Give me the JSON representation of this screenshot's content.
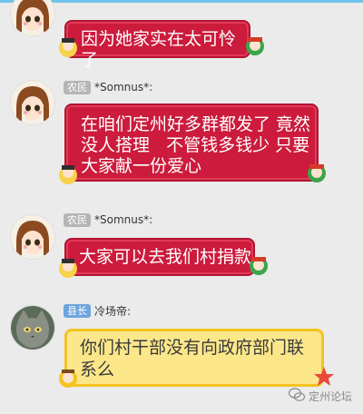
{
  "messages": [
    {
      "text": "因为她家实在太可怜了",
      "avatar": "girl-avatar"
    },
    {
      "rank": "农民",
      "nick": "*Somnus*:",
      "text_lines": [
        "在咱们定州好多群都发了 竟然",
        "没人搭理   不管钱多钱少 只要",
        "大家献一份爱心"
      ],
      "avatar": "girl-avatar"
    },
    {
      "rank": "农民",
      "nick": "*Somnus*:",
      "text": "大家可以去我们村捐款",
      "avatar": "girl-avatar"
    },
    {
      "rank": "县长",
      "nick": "冷场帝:",
      "text_lines": [
        "你们村干部没有向政府部门联",
        "系么"
      ],
      "avatar": "cat-avatar"
    }
  ],
  "watermark": {
    "icon": "wechat-icon",
    "text": "定州论坛"
  },
  "colors": {
    "red_bubble": "#cc1b3c",
    "yellow_bubble": "#fbe78a",
    "rank_gray": "#b5b5b5",
    "rank_blue": "#6ea4de",
    "background": "#ebebeb"
  }
}
